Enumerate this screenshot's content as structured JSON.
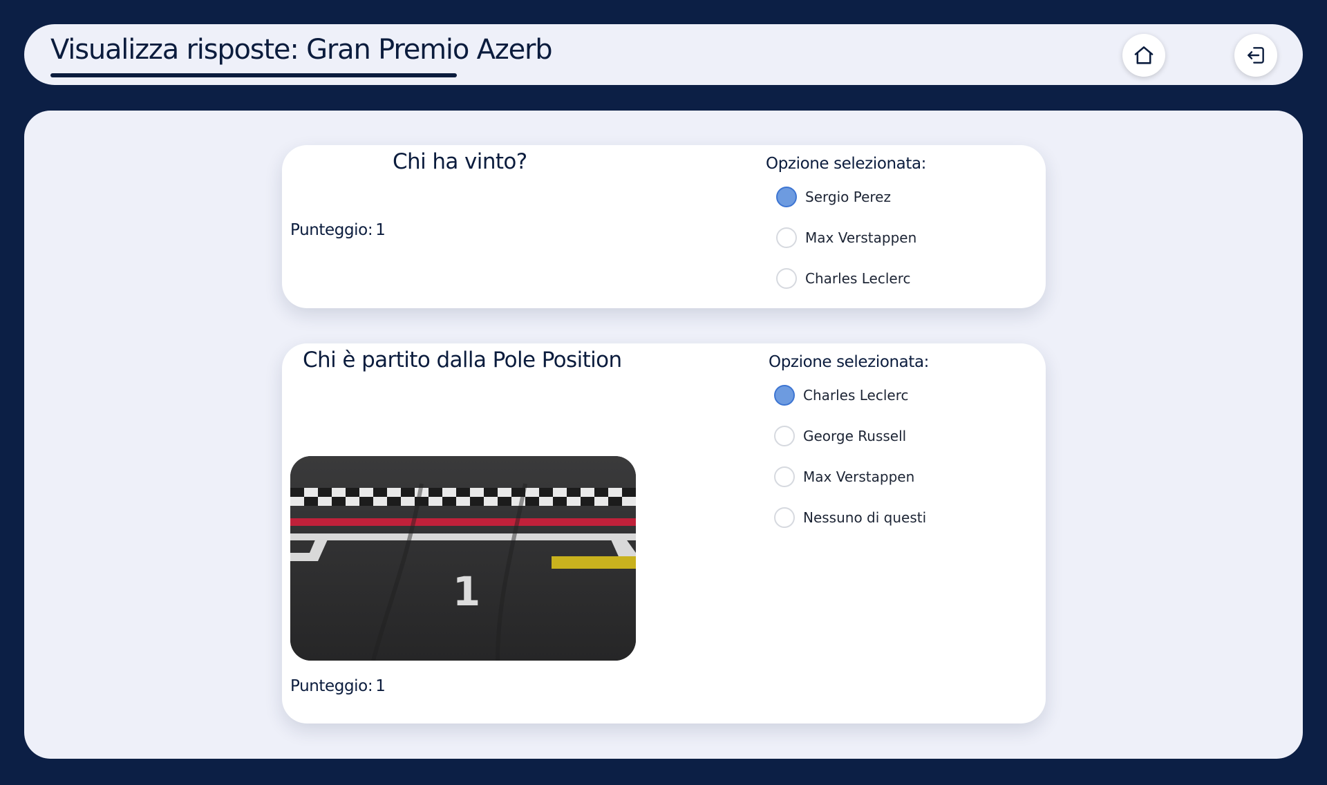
{
  "header": {
    "title": "Visualizza risposte: Gran Premio Azerb",
    "home_icon": "home-icon",
    "logout_icon": "logout-icon"
  },
  "questions": [
    {
      "title": "Chi ha vinto?",
      "score_label": "Punteggio:",
      "score_value": "1",
      "options_label": "Opzione selezionata:",
      "options": [
        {
          "label": "Sergio Perez",
          "selected": true
        },
        {
          "label": "Max Verstappen",
          "selected": false
        },
        {
          "label": "Charles Leclerc",
          "selected": false
        }
      ]
    },
    {
      "title": "Chi è partito dalla Pole Position",
      "score_label": "Punteggio:",
      "score_value": "1",
      "options_label": "Opzione selezionata:",
      "image": {
        "grid_number": "1"
      },
      "options": [
        {
          "label": "Charles Leclerc",
          "selected": true
        },
        {
          "label": "George Russell",
          "selected": false
        },
        {
          "label": "Max Verstappen",
          "selected": false
        },
        {
          "label": "Nessuno di questi",
          "selected": false
        }
      ]
    }
  ],
  "colors": {
    "background": "#0c1f45",
    "panel": "#eef0f9",
    "selected_radio": "#6d9be0",
    "text": "#0b1c3d"
  }
}
